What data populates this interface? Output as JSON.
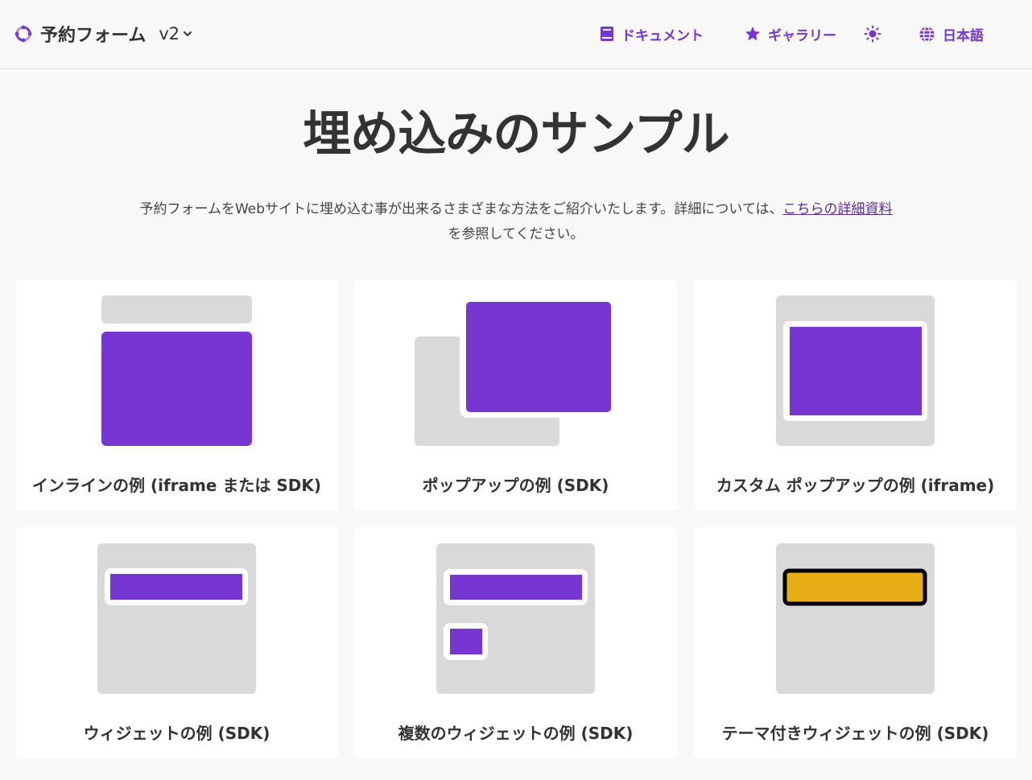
{
  "header": {
    "brand_name": "予約フォーム",
    "version": "v2",
    "nav": {
      "docs": "ドキュメント",
      "gallery": "ギャラリー",
      "language": "日本語"
    },
    "icons": {
      "brand": "brand-logo-icon",
      "version": "chevron-down-icon",
      "docs": "book-icon",
      "gallery": "star-icon",
      "theme": "sun-icon",
      "language": "globe-icon"
    }
  },
  "main": {
    "title": "埋め込みのサンプル",
    "description_before": "予約フォームをWebサイトに埋め込む事が出来るさまざまな方法をご紹介いたします。詳細については、",
    "description_link": "こちらの詳細資料",
    "description_after": "を参照してください。"
  },
  "cards": [
    {
      "label": "インラインの例 (iframe または SDK)"
    },
    {
      "label": "ポップアップの例 (SDK)"
    },
    {
      "label": "カスタム ポップアップの例 (iframe)"
    },
    {
      "label": "ウィジェットの例 (SDK)"
    },
    {
      "label": "複数のウィジェットの例 (SDK)"
    },
    {
      "label": "テーマ付きウィジェットの例 (SDK)"
    }
  ],
  "colors": {
    "accent": "#7735d2",
    "placeholder": "#d9d9d9",
    "theme_widget": "#e8ae17",
    "background": "#f8f8f8",
    "card": "#ffffff"
  }
}
